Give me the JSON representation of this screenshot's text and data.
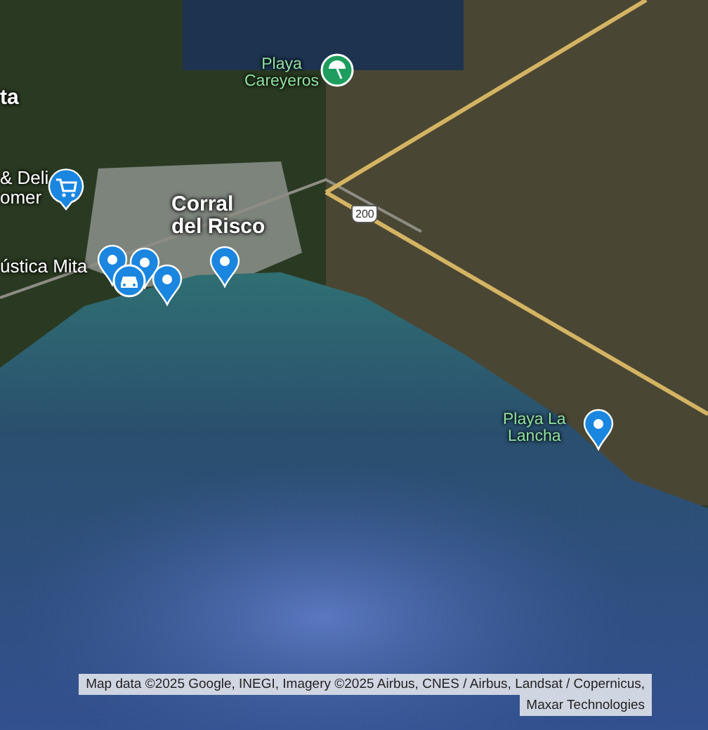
{
  "labels": [
    {
      "lines": [
        "ta"
      ],
      "kind": "town"
    },
    {
      "lines": [
        "& Deli",
        "omer"
      ],
      "kind": "poi"
    },
    {
      "lines": [
        "Corral",
        "del Risco"
      ],
      "kind": "town"
    },
    {
      "lines": [
        "ústica Mita"
      ],
      "kind": "poi"
    },
    {
      "lines": [
        "Playa",
        "Careyeros"
      ],
      "kind": "park"
    },
    {
      "lines": [
        "Playa La",
        "Lancha"
      ],
      "kind": "park"
    }
  ],
  "markers": [
    {
      "kind": "beach"
    },
    {
      "kind": "shopping"
    },
    {
      "kind": "pin"
    },
    {
      "kind": "pin"
    },
    {
      "kind": "car"
    },
    {
      "kind": "pin"
    },
    {
      "kind": "pin"
    },
    {
      "kind": "pin"
    }
  ],
  "road_shield": "200",
  "attribution": [
    "Map data ©2025 Google, INEGI, Imagery ©2025 Airbus, CNES / Airbus, Landsat / Copernicus,",
    "Maxar Technologies"
  ]
}
